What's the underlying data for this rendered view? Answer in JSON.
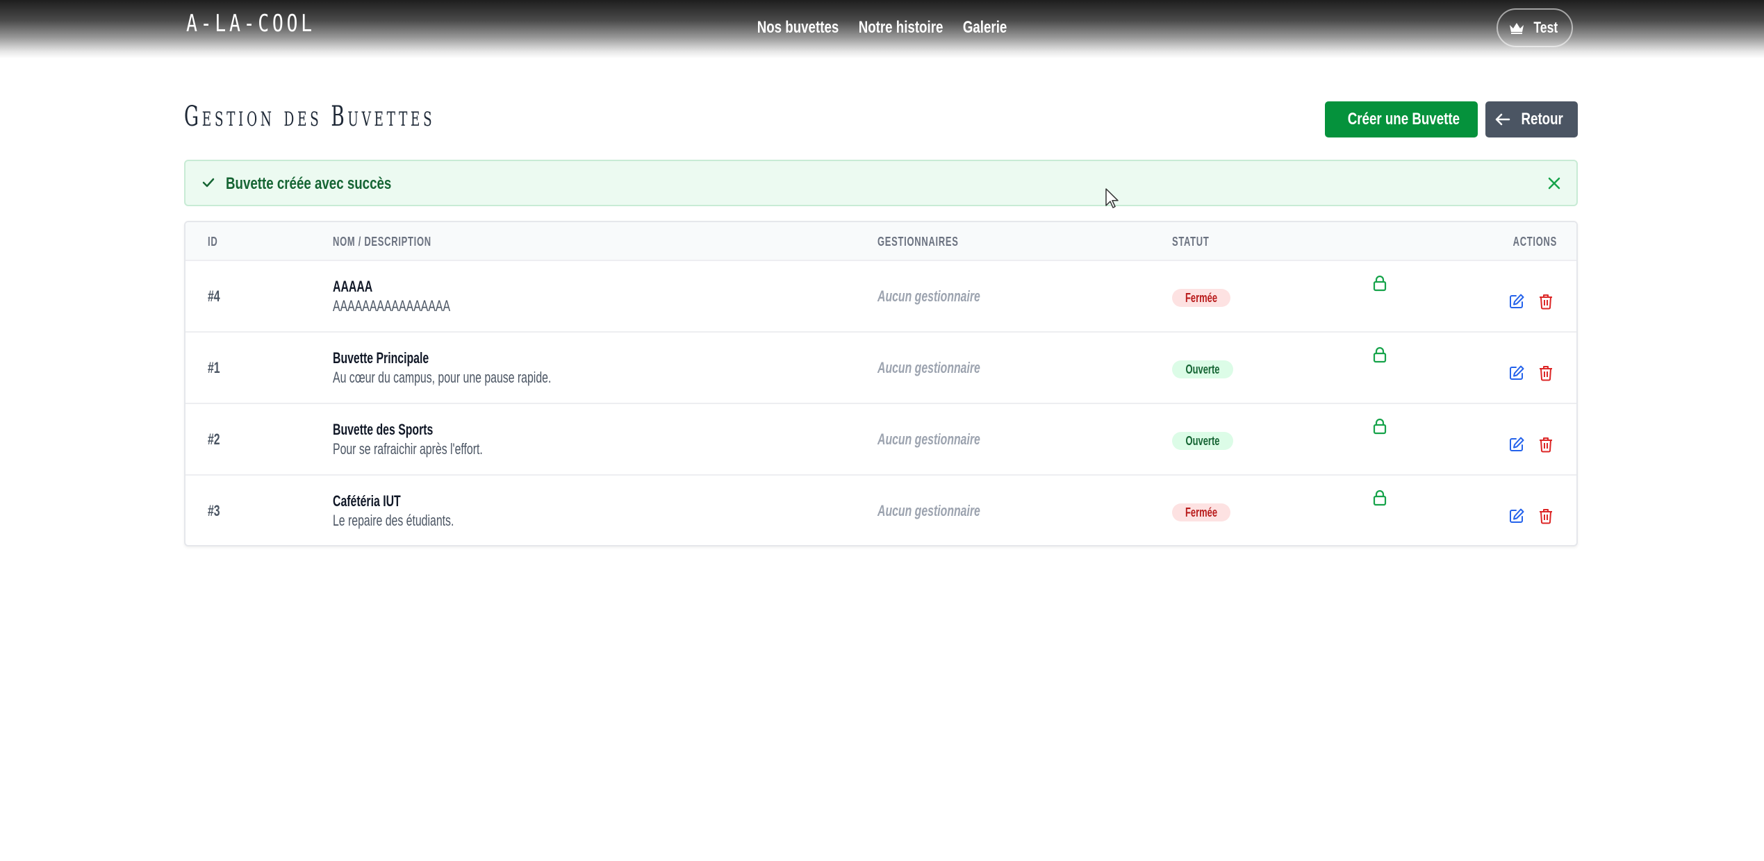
{
  "header": {
    "logo": "A-LA-COOL",
    "nav": [
      "Nos buvettes",
      "Notre histoire",
      "Galerie"
    ],
    "user_label": "Test",
    "user_icon": "crown-icon"
  },
  "page": {
    "title": "Gestion des Buvettes",
    "create_label": "Créer une Buvette",
    "back_label": "Retour"
  },
  "alert": {
    "message": "Buvette créée avec succès"
  },
  "table": {
    "headers": {
      "id": "ID",
      "name": "Nom / Description",
      "managers": "Gestionnaires",
      "status": "Statut",
      "actions": "Actions"
    },
    "rows": [
      {
        "id": "#4",
        "name": "AAAAA",
        "description": "AAAAAAAAAAAAAAAA",
        "managers": "Aucun gestionnaire",
        "status": "Fermée",
        "status_type": "closed"
      },
      {
        "id": "#1",
        "name": "Buvette Principale",
        "description": "Au cœur du campus, pour une pause rapide.",
        "managers": "Aucun gestionnaire",
        "status": "Ouverte",
        "status_type": "open"
      },
      {
        "id": "#2",
        "name": "Buvette des Sports",
        "description": "Pour se rafraichir après l'effort.",
        "managers": "Aucun gestionnaire",
        "status": "Ouverte",
        "status_type": "open"
      },
      {
        "id": "#3",
        "name": "Cafétéria IUT",
        "description": "Le repaire des étudiants.",
        "managers": "Aucun gestionnaire",
        "status": "Fermée",
        "status_type": "closed"
      }
    ]
  },
  "colors": {
    "create_button": "#05923c",
    "back_button": "#4b5563",
    "alert_bg": "#ecfaf1",
    "alert_text": "#166534",
    "closed_badge_bg": "#fde2e2",
    "closed_badge_text": "#b91c1c",
    "open_badge_bg": "#dcfce7",
    "open_badge_text": "#166534",
    "edit_icon": "#2563eb",
    "delete_icon": "#dc2626",
    "lock_icon": "#16a34a"
  },
  "icons": {
    "create": "plus-icon",
    "back": "arrow-left-icon",
    "alert": "check-icon",
    "close": "close-icon",
    "lock": "lock-icon",
    "edit": "edit-icon",
    "delete": "trash-icon"
  }
}
